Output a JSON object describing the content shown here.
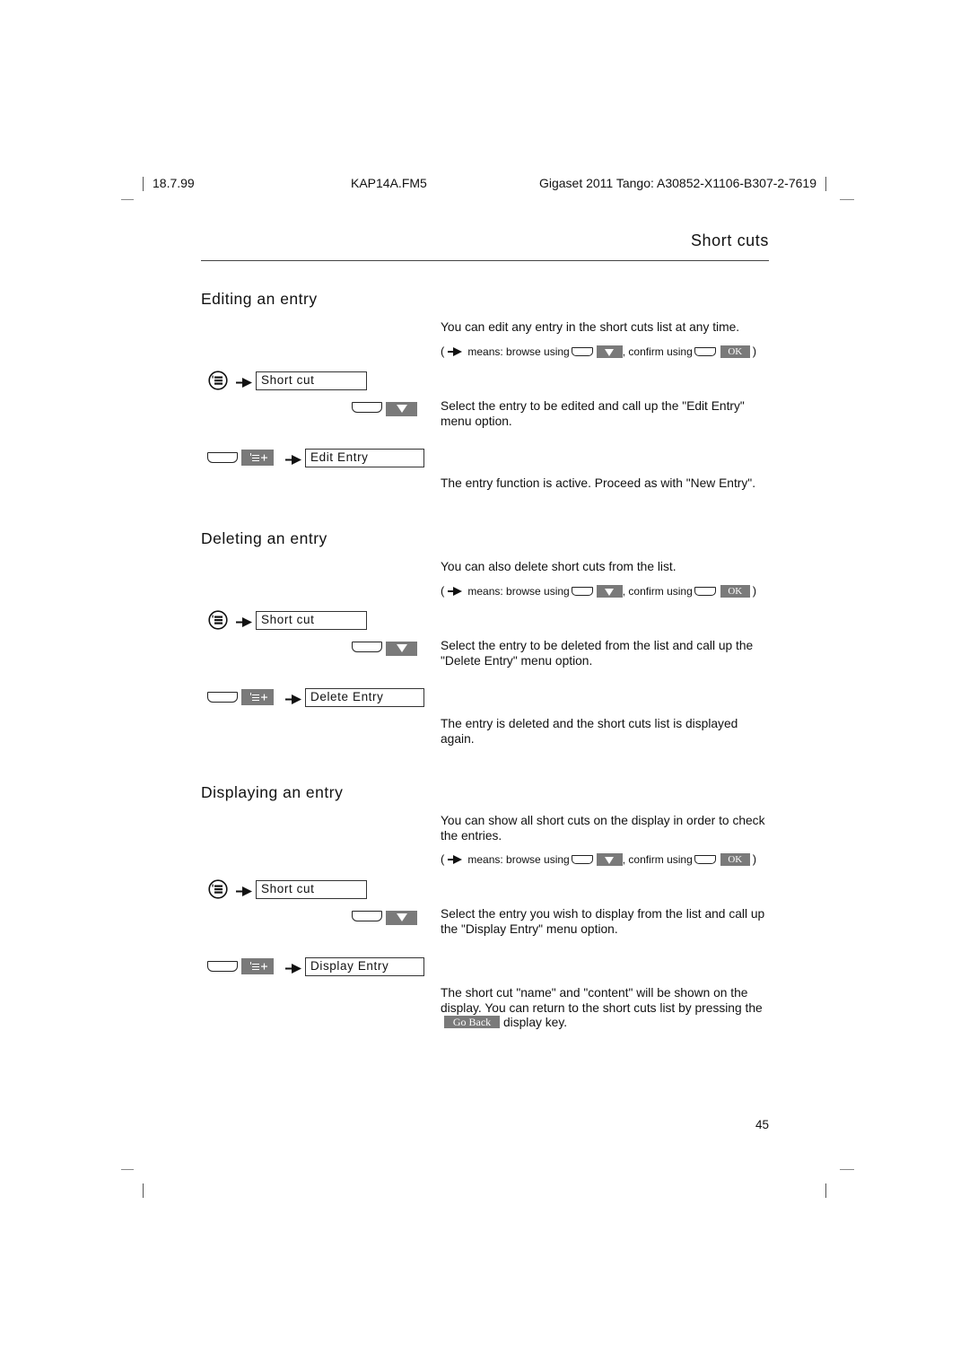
{
  "header": {
    "date": "18.7.99",
    "file": "KAP14A.FM5",
    "product": "Gigaset 2011 Tango: A30852-X1106-B307-2-7619"
  },
  "chapter_title": "Short cuts",
  "legend": {
    "open_paren": "(",
    "means_browse": "means: browse using",
    "confirm": ", confirm using",
    "ok_key": "OK",
    "close_paren": ")"
  },
  "sections": [
    {
      "title": "Editing an entry",
      "intro": "You can edit any entry in the short cuts list at any time.",
      "display_1": "Short cut",
      "step_select": "Select the entry to be edited and call up the \"Edit Entry\" menu option.",
      "display_2": "Edit Entry",
      "result": "The entry function is active. Proceed as with \"New Entry\"."
    },
    {
      "title": "Deleting an entry",
      "intro": "You can also delete short cuts from the list.",
      "display_1": "Short cut",
      "step_select": "Select the entry to be deleted from the list and call up the \"Delete Entry\" menu option.",
      "display_2": "Delete Entry",
      "result": "The entry is deleted and the short cuts list is displayed again."
    },
    {
      "title": "Displaying an entry",
      "intro": "You can show all short cuts on the display in order to check the entries.",
      "display_1": "Short cut",
      "step_select": "Select the entry you wish to display from the list and call up the \"Display Entry\" menu option.",
      "display_2": "Display Entry",
      "result_pre": "The short cut \"name\" and \"content\" will be shown on the display. You can return to the short cuts list by pressing the",
      "go_back_key": "Go Back",
      "result_post": "display key."
    }
  ],
  "page_number": "45",
  "icons": {
    "menu": "menu-list-icon",
    "arrow": "arrow-right-icon",
    "softkey": "softkey-icon",
    "down": "down-triangle-icon",
    "menu_add": "menu-add-icon"
  }
}
